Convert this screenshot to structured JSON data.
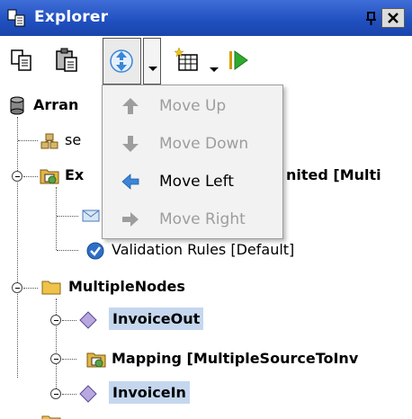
{
  "window": {
    "title": "Explorer"
  },
  "menu": {
    "items": [
      {
        "label": "Move Up",
        "enabled": false,
        "icon": "arrow-up-icon"
      },
      {
        "label": "Move Down",
        "enabled": false,
        "icon": "arrow-down-icon"
      },
      {
        "label": "Move Left",
        "enabled": true,
        "icon": "arrow-left-icon"
      },
      {
        "label": "Move Right",
        "enabled": false,
        "icon": "arrow-right-icon"
      }
    ]
  },
  "tree": {
    "root": {
      "label": "Arran",
      "icon": "database-icon"
    },
    "items": [
      {
        "label": "se",
        "icon": "schema-icon"
      },
      {
        "label": "Ex",
        "label_tail": "nited [Multi",
        "icon": "mapping-folder-icon"
      },
      {
        "label": "",
        "icon": "envelope-icon"
      },
      {
        "label": "Validation Rules [Default]",
        "icon": "checkmark-icon"
      },
      {
        "label": "MultipleNodes",
        "icon": "folder-icon"
      },
      {
        "label": "InvoiceOut",
        "icon": "diamond-icon",
        "selected": true
      },
      {
        "label": "Mapping [MultipleSourceToInv",
        "icon": "mapping-folder-icon"
      },
      {
        "label": "InvoiceIn",
        "icon": "diamond-icon",
        "selected": true
      }
    ]
  },
  "colors": {
    "titlebar": "#1f4fbf",
    "selection": "#c5d7ef",
    "menu_bg": "#f2f2f2",
    "disabled_text": "#9d9d9d",
    "arrow_blue": "#3a86d8"
  }
}
